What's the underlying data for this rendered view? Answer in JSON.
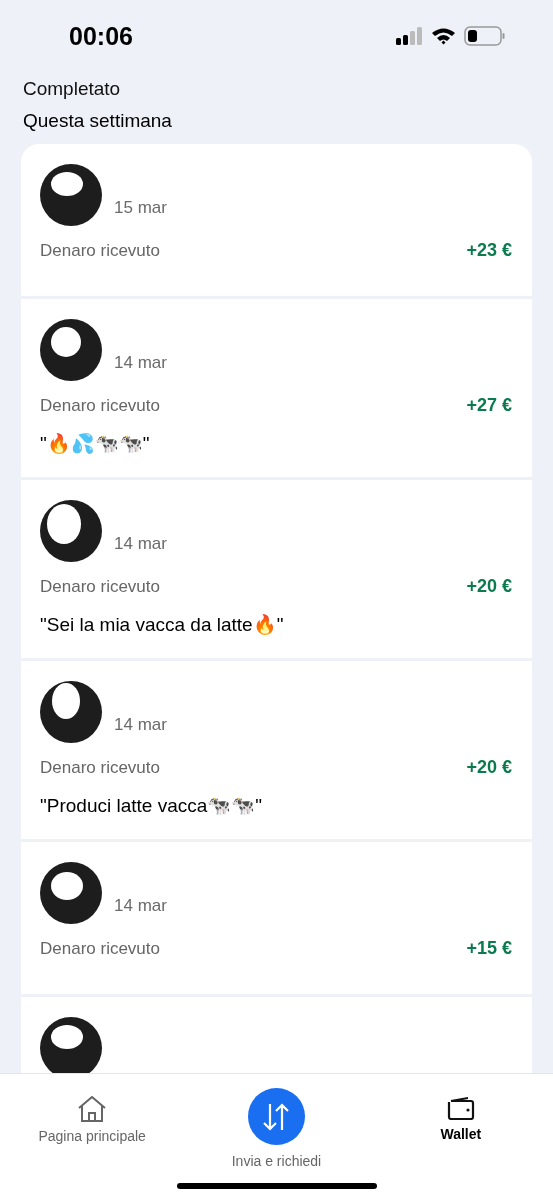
{
  "status_bar": {
    "time": "00:06"
  },
  "section_title": "Completato",
  "group_title": "Questa settimana",
  "transactions": [
    {
      "date": "15 mar",
      "description": "Denaro ricevuto",
      "amount": "+23 €"
    },
    {
      "date": "14 mar",
      "description": "Denaro ricevuto",
      "amount": "+27 €",
      "message": "\"🔥💦🐄🐄\""
    },
    {
      "date": "14 mar",
      "description": "Denaro ricevuto",
      "amount": "+20 €",
      "message": "\"Sei la mia vacca da latte🔥\""
    },
    {
      "date": "14 mar",
      "description": "Denaro ricevuto",
      "amount": "+20 €",
      "message": "\"Produci latte vacca🐄🐄\""
    },
    {
      "date": "14 mar",
      "description": "Denaro ricevuto",
      "amount": "+15 €"
    }
  ],
  "nav": [
    {
      "kind": "home",
      "label": "Pagina principale",
      "selected": false
    },
    {
      "kind": "transfer",
      "label": "Invia e richiedi",
      "selected": false
    },
    {
      "kind": "wallet",
      "label": "Wallet",
      "selected": true
    }
  ]
}
